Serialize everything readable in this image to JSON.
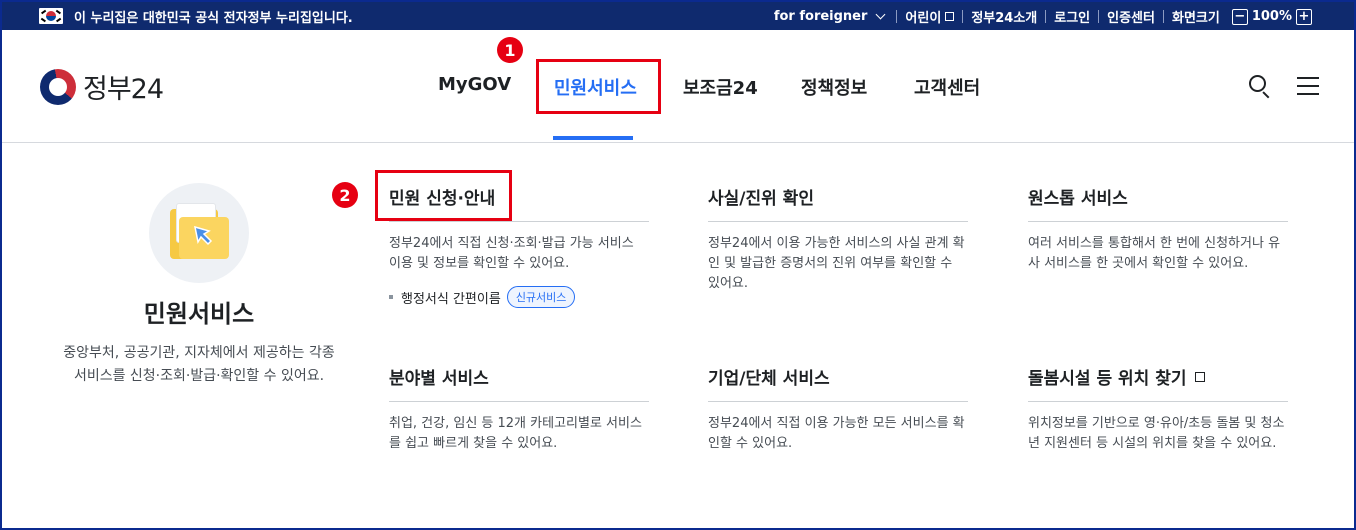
{
  "topbar": {
    "notice": "이 누리집은 대한민국 공식 전자정부 누리집입니다.",
    "foreigner": "for foreigner",
    "kids": "어린이",
    "about": "정부24소개",
    "login": "로그인",
    "cert": "인증센터",
    "zoom_label": "화면크기",
    "zoom_minus": "−",
    "zoom_value": "100%",
    "zoom_plus": "+"
  },
  "header": {
    "logo_text": "정부24",
    "nav": [
      "MyGOV",
      "민원서비스",
      "보조금24",
      "정책정보",
      "고객센터"
    ],
    "active_nav": "민원서비스"
  },
  "annotations": {
    "badge1": "1",
    "badge2": "2"
  },
  "colors": {
    "primary": "#256ef4",
    "navy": "#0f2a6e",
    "highlight": "#e60012"
  },
  "side": {
    "title": "민원서비스",
    "desc": "중앙부처, 공공기관, 지자체에서 제공하는 각종 서비스를 신청·조회·발급·확인할 수 있어요."
  },
  "columns": [
    {
      "title": "민원 신청·안내",
      "desc": "정부24에서 직접 신청·조회·발급 가능 서비스 이용 및 정보를 확인할 수 있어요.",
      "sub": "행정서식 간편이름",
      "pill": "신규서비스"
    },
    {
      "title": "사실/진위 확인",
      "desc": "정부24에서 이용 가능한 서비스의 사실 관계 확인 및 발급한 증명서의 진위 여부를 확인할 수 있어요."
    },
    {
      "title": "원스톱 서비스",
      "desc": "여러 서비스를 통합해서 한 번에 신청하거나 유사 서비스를 한 곳에서 확인할 수 있어요."
    },
    {
      "title": "분야별 서비스",
      "desc": "취업, 건강, 임신 등 12개 카테고리별로 서비스를 쉽고 빠르게 찾을 수 있어요."
    },
    {
      "title": "기업/단체 서비스",
      "desc": "정부24에서 직접 이용 가능한 모든 서비스를 확인할 수 있어요."
    },
    {
      "title": "돌봄시설 등 위치 찾기",
      "desc": "위치정보를 기반으로 영·유아/초등 돌봄 및 청소년 지원센터 등 시설의 위치를 찾을 수 있어요."
    }
  ]
}
